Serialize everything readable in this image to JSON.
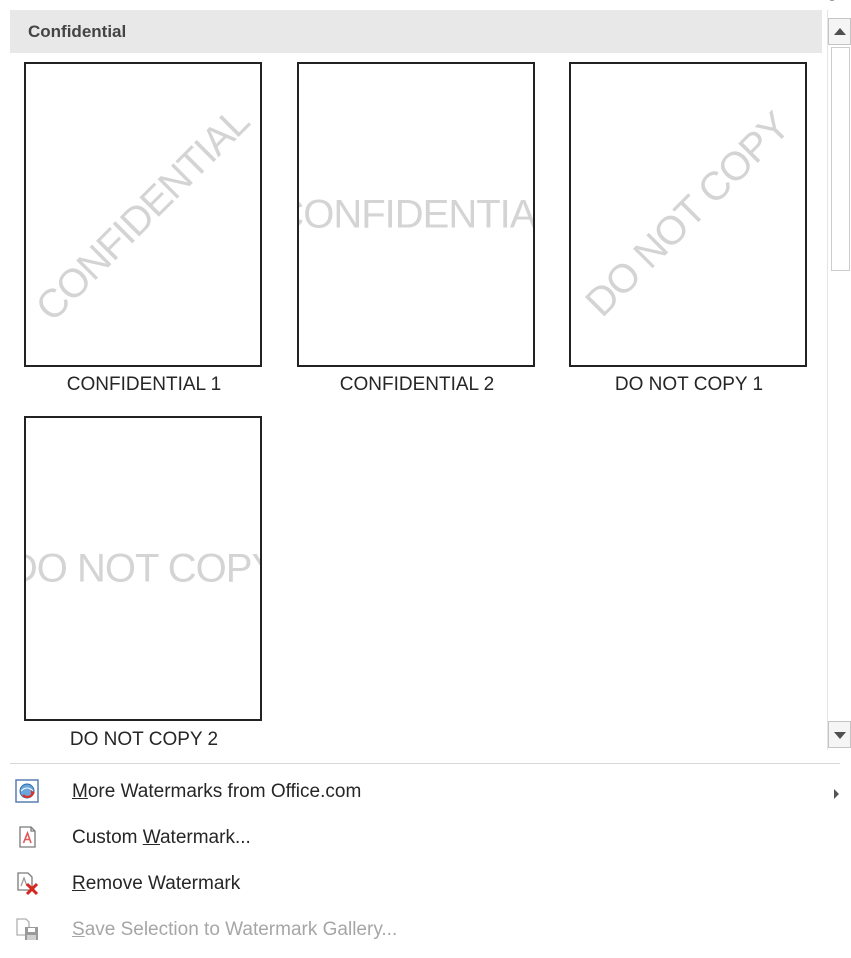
{
  "gallery": {
    "section_title": "Confidential",
    "tiles": [
      {
        "watermark": "CONFIDENTIAL",
        "caption": "CONFIDENTIAL 1",
        "orientation": "diagonal"
      },
      {
        "watermark": "CONFIDENTIAL",
        "caption": "CONFIDENTIAL 2",
        "orientation": "horizontal"
      },
      {
        "watermark": "DO NOT COPY",
        "caption": "DO NOT COPY 1",
        "orientation": "diagonal"
      },
      {
        "watermark": "DO NOT COPY",
        "caption": "DO NOT COPY 2",
        "orientation": "horizontal"
      }
    ]
  },
  "menu": {
    "more_watermarks": {
      "pre": "",
      "key": "M",
      "post": "ore Watermarks from Office.com",
      "icon": "globe-refresh-icon"
    },
    "custom_watermark": {
      "pre": "Custom ",
      "key": "W",
      "post": "atermark...",
      "icon": "watermark-document-icon"
    },
    "remove_watermark": {
      "pre": "",
      "key": "R",
      "post": "emove Watermark",
      "icon": "remove-watermark-icon"
    },
    "save_selection": {
      "pre": "",
      "key": "S",
      "post": "ave Selection to Watermark Gallery...",
      "icon": "save-gallery-icon",
      "disabled": true
    }
  },
  "colors": {
    "header_bg": "#e8e8e8",
    "watermark_text": "#d4d4d4",
    "disabled_text": "#a6a6a6"
  }
}
